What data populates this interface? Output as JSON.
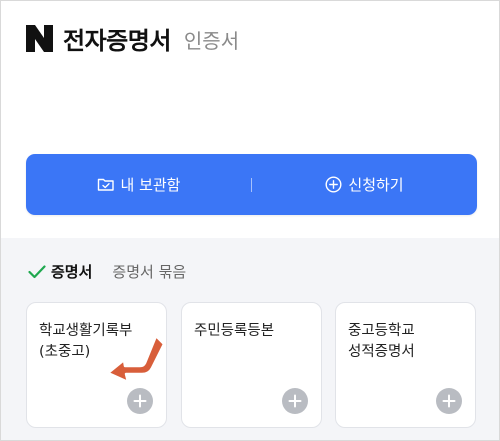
{
  "header": {
    "logo_letter": "N",
    "title": "전자증명서",
    "subtitle": "인증서"
  },
  "action_bar": {
    "vault_label": "내 보관함",
    "apply_label": "신청하기"
  },
  "tabs": {
    "active": "증명서",
    "other": "증명서 묶음"
  },
  "cards": [
    {
      "label": "학교생활기록부\n(초중고)"
    },
    {
      "label": "주민등록등본"
    },
    {
      "label": "중고등학교\n성적증명서"
    }
  ],
  "colors": {
    "accent": "#3b76f6",
    "check": "#1fa84f",
    "arrow": "#d85e3a",
    "plus_bg": "#b9bcc2",
    "section_bg": "#f4f5f8"
  }
}
